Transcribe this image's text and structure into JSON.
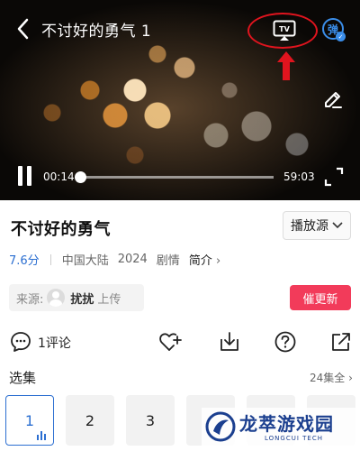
{
  "player": {
    "title": "不讨好的勇气 1",
    "cast_label": "TV",
    "danmu_label": "弹",
    "current_time": "00:14",
    "total_time": "59:03",
    "progress": 0.004
  },
  "info": {
    "title": "不讨好的勇气",
    "source_button": "播放源",
    "score": "7.6分",
    "region": "中国大陆",
    "year": "2024",
    "genre": "剧情",
    "intro": "简介",
    "uploader_label": "来源:",
    "uploader_name": "扰扰",
    "uploader_action": "上传",
    "update_button": "催更新"
  },
  "actions": {
    "comment_label": "1评论"
  },
  "episodes": {
    "label": "选集",
    "count": "24集全",
    "items": [
      "1",
      "2",
      "3"
    ]
  },
  "watermark": {
    "title": "龙萃游戏园",
    "subtitle": "LONGCUI TECH"
  },
  "colors": {
    "accent_blue": "#2c6fd1",
    "update_red": "#f23b5a",
    "highlight_red": "#e0141e"
  }
}
